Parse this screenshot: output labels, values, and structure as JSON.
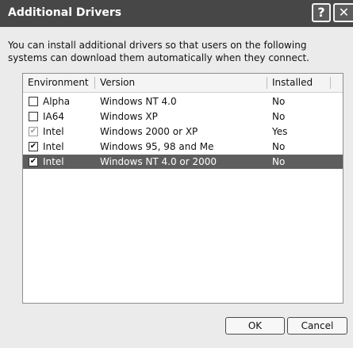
{
  "window": {
    "title": "Additional Drivers",
    "help_glyph": "?",
    "close_glyph": "✕"
  },
  "description": "You can install additional drivers so that users on the following systems can download them automatically when they connect.",
  "table": {
    "columns": [
      "Environment",
      "Version",
      "Installed"
    ],
    "rows": [
      {
        "environment": "Alpha",
        "version": "Windows NT 4.0",
        "installed": "No",
        "checked": false,
        "disabled": false,
        "selected": false
      },
      {
        "environment": "IA64",
        "version": "Windows XP",
        "installed": "No",
        "checked": false,
        "disabled": false,
        "selected": false
      },
      {
        "environment": "Intel",
        "version": "Windows 2000 or XP",
        "installed": "Yes",
        "checked": true,
        "disabled": true,
        "selected": false
      },
      {
        "environment": "Intel",
        "version": "Windows 95, 98 and Me",
        "installed": "No",
        "checked": true,
        "disabled": false,
        "selected": false
      },
      {
        "environment": "Intel",
        "version": "Windows NT 4.0 or 2000",
        "installed": "No",
        "checked": true,
        "disabled": false,
        "selected": true
      }
    ]
  },
  "buttons": {
    "ok": "OK",
    "cancel": "Cancel"
  },
  "colors": {
    "titlebar": "#474747",
    "selection": "#5e5e5e",
    "dialog_bg": "#ebebeb"
  },
  "icons": {
    "help": "help-icon",
    "close": "close-icon",
    "checkbox": "checkbox-icon"
  }
}
